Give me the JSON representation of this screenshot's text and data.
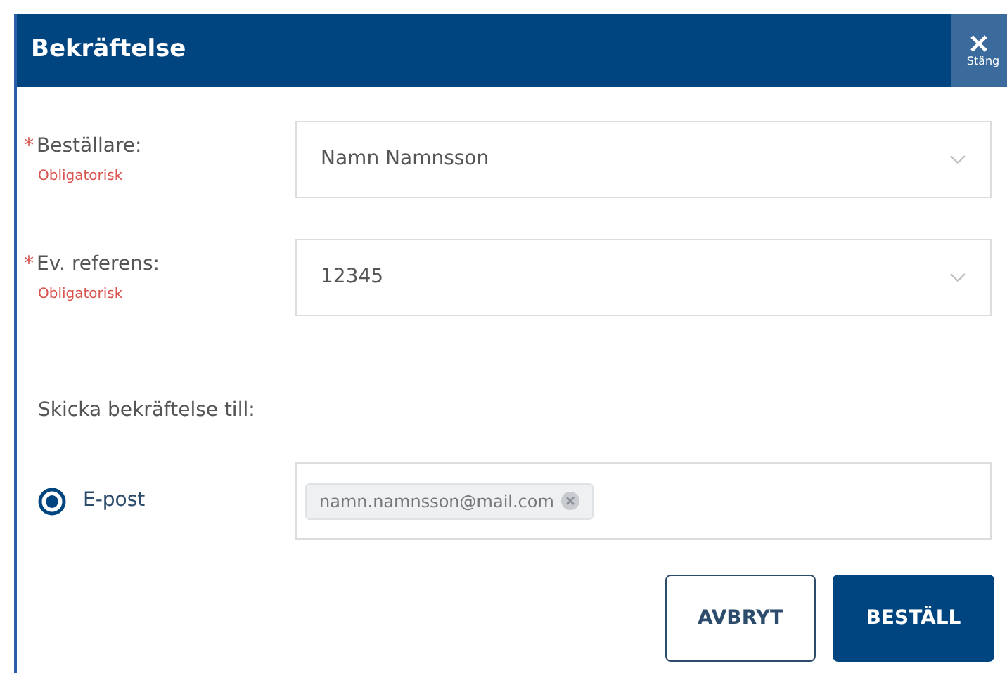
{
  "dialog": {
    "title": "Bekräftelse",
    "close_label": "Stäng"
  },
  "fields": [
    {
      "label": "Beställare:",
      "required_mark": "*",
      "hint": "Obligatorisk",
      "value": "Namn Namnsson"
    },
    {
      "label": "Ev. referens:",
      "required_mark": "*",
      "hint": "Obligatorisk",
      "value": "12345"
    }
  ],
  "send_to": {
    "heading": "Skicka bekräftelse till:",
    "option": {
      "label": "E-post",
      "selected": true
    },
    "tags": [
      "namn.namnsson@mail.com"
    ]
  },
  "buttons": [
    {
      "label": "AVBRYT",
      "kind": "secondary"
    },
    {
      "label": "BESTÄLL",
      "kind": "primary"
    }
  ]
}
